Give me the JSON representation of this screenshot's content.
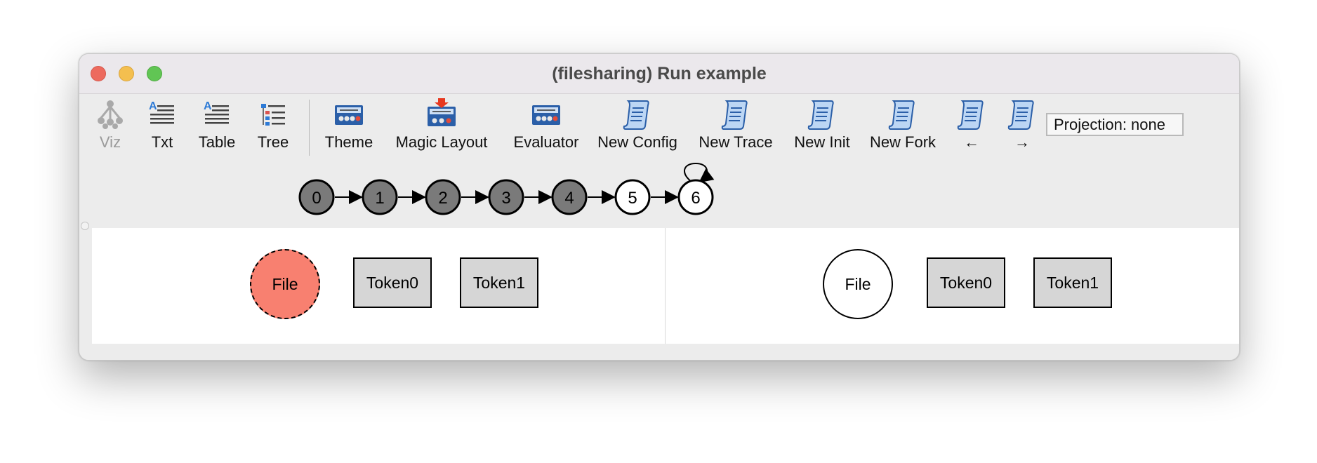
{
  "window": {
    "title": "(filesharing) Run example"
  },
  "toolbar": {
    "buttons": [
      {
        "label": "Viz",
        "icon": "graph-tree-icon",
        "enabled": false
      },
      {
        "label": "Txt",
        "icon": "text-lines-icon"
      },
      {
        "label": "Table",
        "icon": "table-lines-icon"
      },
      {
        "label": "Tree",
        "icon": "tree-list-icon"
      },
      {
        "label": "Theme",
        "icon": "theme-panel-icon"
      },
      {
        "label": "Magic Layout",
        "icon": "magic-layout-icon"
      },
      {
        "label": "Evaluator",
        "icon": "evaluator-panel-icon"
      },
      {
        "label": "New Config",
        "icon": "scroll-icon"
      },
      {
        "label": "New Trace",
        "icon": "scroll-icon"
      },
      {
        "label": "New Init",
        "icon": "scroll-icon"
      },
      {
        "label": "New Fork",
        "icon": "scroll-icon"
      },
      {
        "label": "←",
        "icon": "scroll-icon"
      },
      {
        "label": "→",
        "icon": "scroll-icon"
      }
    ],
    "projection": "Projection: none"
  },
  "trace": {
    "states": [
      {
        "label": "0",
        "visited": true
      },
      {
        "label": "1",
        "visited": true
      },
      {
        "label": "2",
        "visited": true
      },
      {
        "label": "3",
        "visited": true
      },
      {
        "label": "4",
        "visited": true
      },
      {
        "label": "5",
        "visited": false
      },
      {
        "label": "6",
        "visited": false,
        "self_loop": true
      }
    ]
  },
  "panels": {
    "left": {
      "file": "File",
      "token0": "Token0",
      "token1": "Token1",
      "file_fill": "#f88070"
    },
    "right": {
      "file": "File",
      "token0": "Token0",
      "token1": "Token1"
    }
  },
  "colors": {
    "state_visited": "#7a7a7a",
    "state_unvisited": "#ffffff",
    "atom_box": "#d6d6d6"
  }
}
